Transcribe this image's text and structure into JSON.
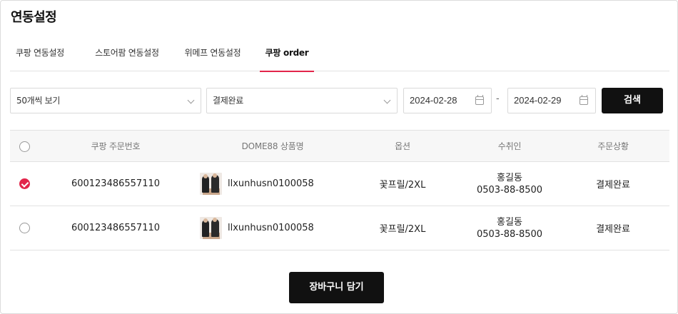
{
  "page": {
    "title": "연동설정"
  },
  "tabs": [
    {
      "label": "쿠팡 연동설정",
      "active": false
    },
    {
      "label": "스토어팜 연동설정",
      "active": false
    },
    {
      "label": "위메프 연동설정",
      "active": false
    },
    {
      "label": "쿠팡 order",
      "active": true
    }
  ],
  "filters": {
    "page_size": "50개씩 보기",
    "status": "결제완료",
    "date_from": "2024-02-28",
    "date_to": "2024-02-29",
    "date_separator": "-",
    "search_label": "검색"
  },
  "table": {
    "headers": [
      "쿠팡 주문번호",
      "DOME88 상품명",
      "옵션",
      "수취인",
      "주문상황"
    ],
    "rows": [
      {
        "selected": true,
        "order_no": "600123486557110",
        "product": "llxunhusn0100058",
        "option": "꽃프릴/2XL",
        "recipient_name": "홍길동",
        "recipient_phone": "0503-88-8500",
        "status": "결제완료"
      },
      {
        "selected": false,
        "order_no": "600123486557110",
        "product": "llxunhusn0100058",
        "option": "꽃프릴/2XL",
        "recipient_name": "홍길동",
        "recipient_phone": "0503-88-8500",
        "status": "결제완료"
      }
    ]
  },
  "actions": {
    "add_to_cart": "장바구니 담기"
  },
  "colors": {
    "accent": "#e2244a",
    "button_bg": "#111111",
    "header_bg": "#f7f7f7"
  },
  "icons": {
    "calendar": "calendar-icon",
    "dropdown": "chevron-down-icon",
    "check": "check-icon"
  }
}
